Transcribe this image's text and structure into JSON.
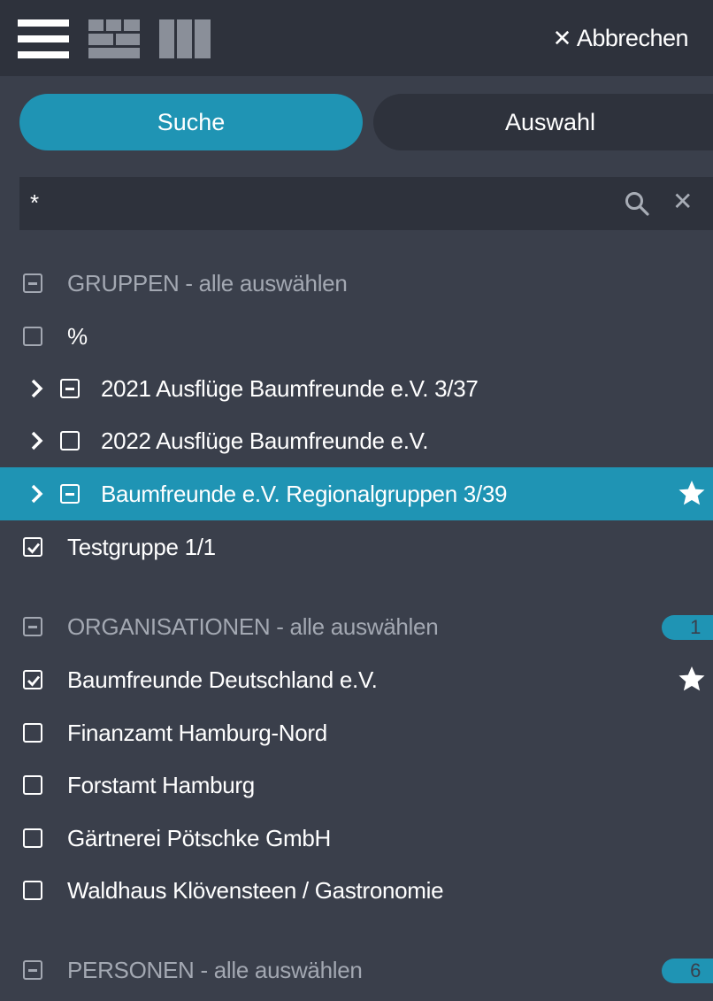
{
  "toolbar": {
    "cancel_label": "Abbrechen",
    "cancel_icon": "close-icon",
    "view_icons": [
      "list-view-icon",
      "grid-view-icon",
      "column-view-icon"
    ]
  },
  "tabs": [
    {
      "label": "Suche",
      "active": true
    },
    {
      "label": "Auswahl",
      "active": false
    }
  ],
  "search": {
    "value": "*",
    "search_icon": "search-icon",
    "clear_icon": "close-icon"
  },
  "groups": {
    "header": "GRUPPEN - alle auswählen",
    "items": [
      {
        "label": "%",
        "state": "unchecked",
        "expandable": false
      },
      {
        "label": "2021 Ausflüge Baumfreunde e.V. 3/37",
        "state": "partial",
        "expandable": true
      },
      {
        "label": "2022 Ausflüge Baumfreunde e.V.",
        "state": "unchecked",
        "expandable": true
      },
      {
        "label": "Baumfreunde e.V. Regionalgruppen 3/39",
        "state": "partial",
        "expandable": true,
        "highlighted": true,
        "favorite": true
      },
      {
        "label": "Testgruppe 1/1",
        "state": "checked",
        "expandable": false
      }
    ]
  },
  "organisations": {
    "header": "ORGANISATIONEN - alle auswählen",
    "count": "1",
    "items": [
      {
        "label": "Baumfreunde Deutschland e.V.",
        "state": "checked",
        "favorite": true
      },
      {
        "label": "Finanzamt Hamburg-Nord",
        "state": "unchecked"
      },
      {
        "label": "Forstamt Hamburg",
        "state": "unchecked"
      },
      {
        "label": "Gärtnerei Pötschke GmbH",
        "state": "unchecked"
      },
      {
        "label": "Waldhaus Klövensteen / Gastronomie",
        "state": "unchecked"
      }
    ]
  },
  "persons": {
    "header": "PERSONEN - alle auswählen",
    "count": "6"
  },
  "colors": {
    "accent": "#1f94b4",
    "background": "#3a3f4b",
    "toolbar": "#2e323c",
    "muted_text": "#a3a8b2"
  }
}
